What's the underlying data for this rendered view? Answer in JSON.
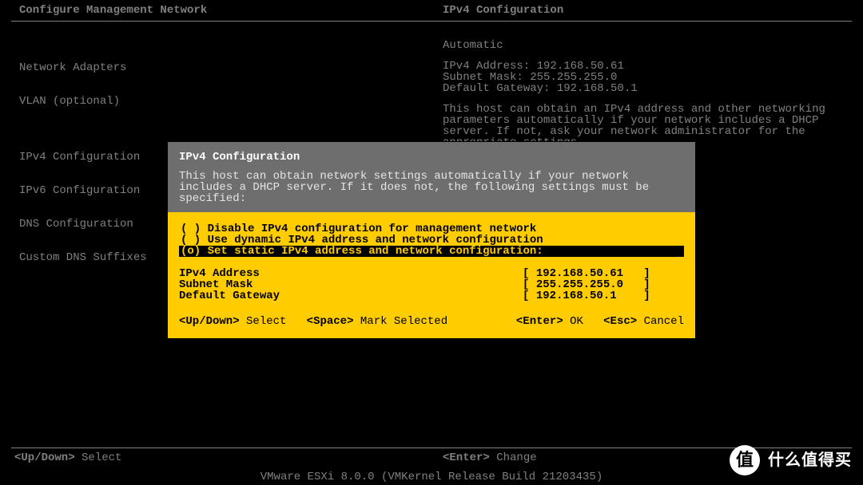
{
  "header": {
    "left": "Configure Management Network",
    "right": "IPv4 Configuration"
  },
  "menu": {
    "items": [
      "Network Adapters",
      "VLAN (optional)",
      "",
      "IPv4 Configuration",
      "IPv6 Configuration",
      "DNS Configuration",
      "Custom DNS Suffixes"
    ]
  },
  "right_panel": {
    "mode": "Automatic",
    "lines": [
      "IPv4 Address: 192.168.50.61",
      "Subnet Mask: 255.255.255.0",
      "Default Gateway: 192.168.50.1"
    ],
    "desc": "This host can obtain an IPv4 address and other networking parameters automatically if your network includes a DHCP server. If not, ask your network administrator for the appropriate settings."
  },
  "dialog": {
    "title": "IPv4 Configuration",
    "desc": "This host can obtain network settings automatically if your network includes a DHCP server. If it does not, the following settings must be specified:",
    "options": [
      {
        "mark": "( )",
        "label": "Disable IPv4 configuration for management network",
        "selected": false
      },
      {
        "mark": "( )",
        "label": "Use dynamic IPv4 address and network configuration",
        "selected": false
      },
      {
        "mark": "(o)",
        "label": "Set static IPv4 address and network configuration:",
        "selected": true
      }
    ],
    "fields": [
      {
        "label": "IPv4 Address",
        "value": "192.168.50.61"
      },
      {
        "label": "Subnet Mask",
        "value": "255.255.255.0"
      },
      {
        "label": "Default Gateway",
        "value": "192.168.50.1"
      }
    ],
    "footer": {
      "updown_key": "<Up/Down>",
      "updown_hint": "Select",
      "space_key": "<Space>",
      "space_hint": "Mark Selected",
      "enter_key": "<Enter>",
      "enter_hint": "OK",
      "esc_key": "<Esc>",
      "esc_hint": "Cancel"
    }
  },
  "footer": {
    "left_key": "<Up/Down>",
    "left_hint": "Select",
    "right_key": "<Enter>",
    "right_hint": "Change"
  },
  "version": "VMware ESXi 8.0.0 (VMKernel Release Build 21203435)",
  "watermark": {
    "badge": "值",
    "text": "什么值得买"
  }
}
